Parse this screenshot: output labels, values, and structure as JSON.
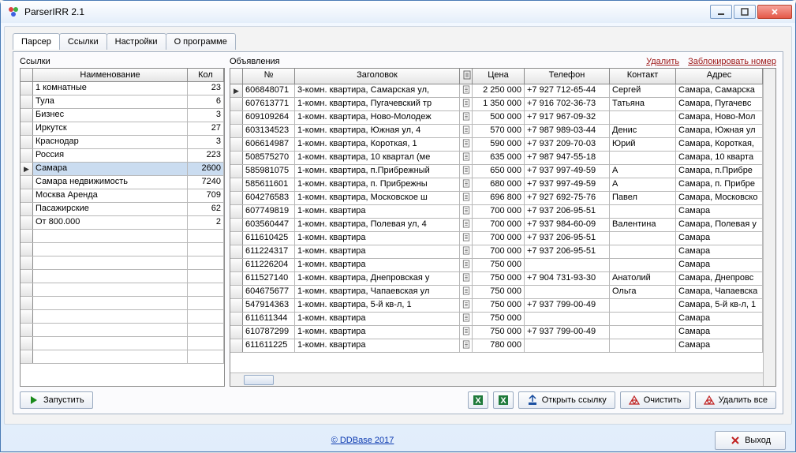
{
  "window": {
    "title": "ParserIRR 2.1"
  },
  "tabs": [
    "Парсер",
    "Ссылки",
    "Настройки",
    "О программе"
  ],
  "left": {
    "title": "Ссылки",
    "headers": [
      "Наименование",
      "Кол"
    ],
    "rows": [
      {
        "name": "1 комнатные",
        "count": "23"
      },
      {
        "name": "Тула",
        "count": "6"
      },
      {
        "name": "Бизнес",
        "count": "3"
      },
      {
        "name": "Иркутск",
        "count": "27"
      },
      {
        "name": "Краснодар",
        "count": "3"
      },
      {
        "name": "Россия",
        "count": "223"
      },
      {
        "name": "Самара",
        "count": "2600",
        "selected": true
      },
      {
        "name": "Самара недвижимость",
        "count": "7240"
      },
      {
        "name": "Москва Аренда",
        "count": "709"
      },
      {
        "name": "Пасажирские",
        "count": "62"
      },
      {
        "name": "От 800.000",
        "count": "2"
      }
    ]
  },
  "right": {
    "title": "Объявления",
    "actions": {
      "delete": "Удалить",
      "block": "Заблокировать номер"
    },
    "headers": {
      "no": "№",
      "title": "Заголовок",
      "price": "Цена",
      "phone": "Телефон",
      "contact": "Контакт",
      "address": "Адрес"
    },
    "rows": [
      {
        "no": "606848071",
        "title": "3-комн. квартира, Самарская ул,",
        "price": "2 250 000",
        "phone": "+7 927 712-65-44",
        "contact": "Сергей",
        "address": "Самара, Самарска",
        "sel": true
      },
      {
        "no": "607613771",
        "title": "1-комн. квартира, Пугачевский тр",
        "price": "1 350 000",
        "phone": "+7 916 702-36-73",
        "contact": "Татьяна",
        "address": "Самара, Пугачевс"
      },
      {
        "no": "609109264",
        "title": "1-комн. квартира, Ново-Молодеж",
        "price": "500 000",
        "phone": "+7 917 967-09-32",
        "contact": "",
        "address": "Самара, Ново-Мол"
      },
      {
        "no": "603134523",
        "title": "1-комн. квартира, Южная ул, 4",
        "price": "570 000",
        "phone": "+7 987 989-03-44",
        "contact": "Денис",
        "address": "Самара, Южная ул"
      },
      {
        "no": "606614987",
        "title": "1-комн. квартира, Короткая, 1",
        "price": "590 000",
        "phone": "+7 937 209-70-03",
        "contact": "Юрий",
        "address": "Самара, Короткая,"
      },
      {
        "no": "508575270",
        "title": "1-комн. квартира, 10 квартал (ме",
        "price": "635 000",
        "phone": "+7 987 947-55-18",
        "contact": "",
        "address": "Самара, 10 кварта"
      },
      {
        "no": "585981075",
        "title": "1-комн. квартира, п.Прибрежный",
        "price": "650 000",
        "phone": "+7 937 997-49-59",
        "contact": "А",
        "address": "Самара, п.Прибре"
      },
      {
        "no": "585611601",
        "title": "1-комн. квартира, п. Прибрежны",
        "price": "680 000",
        "phone": "+7 937 997-49-59",
        "contact": "А",
        "address": "Самара, п. Прибре"
      },
      {
        "no": "604276583",
        "title": "1-комн. квартира, Московское ш",
        "price": "696 800",
        "phone": "+7 927 692-75-76",
        "contact": "Павел",
        "address": "Самара, Московско"
      },
      {
        "no": "607749819",
        "title": "1-комн. квартира",
        "price": "700 000",
        "phone": "+7 937 206-95-51",
        "contact": "",
        "address": "Самара"
      },
      {
        "no": "603560447",
        "title": "1-комн. квартира, Полевая ул, 4",
        "price": "700 000",
        "phone": "+7 937 984-60-09",
        "contact": "Валентина",
        "address": "Самара, Полевая у"
      },
      {
        "no": "611610425",
        "title": "1-комн. квартира",
        "price": "700 000",
        "phone": "+7 937 206-95-51",
        "contact": "",
        "address": "Самара"
      },
      {
        "no": "611224317",
        "title": "1-комн. квартира",
        "price": "700 000",
        "phone": "+7 937 206-95-51",
        "contact": "",
        "address": "Самара"
      },
      {
        "no": "611226204",
        "title": "1-комн. квартира",
        "price": "750 000",
        "phone": "",
        "contact": "",
        "address": "Самара"
      },
      {
        "no": "611527140",
        "title": "1-комн. квартира, Днепровская у",
        "price": "750 000",
        "phone": "+7 904 731-93-30",
        "contact": "Анатолий",
        "address": "Самара, Днепровс"
      },
      {
        "no": "604675677",
        "title": "1-комн. квартира, Чапаевская ул",
        "price": "750 000",
        "phone": "",
        "contact": "Ольга",
        "address": "Самара, Чапаевска"
      },
      {
        "no": "547914363",
        "title": "1-комн. квартира, 5-й кв-л, 1",
        "price": "750 000",
        "phone": "+7 937 799-00-49",
        "contact": "",
        "address": "Самара, 5-й кв-л, 1"
      },
      {
        "no": "611611344",
        "title": "1-комн. квартира",
        "price": "750 000",
        "phone": "",
        "contact": "",
        "address": "Самара"
      },
      {
        "no": "610787299",
        "title": "1-комн. квартира",
        "price": "750 000",
        "phone": "+7 937 799-00-49",
        "contact": "",
        "address": "Самара"
      },
      {
        "no": "611611225",
        "title": "1-комн. квартира",
        "price": "780 000",
        "phone": "",
        "contact": "",
        "address": "Самара"
      }
    ]
  },
  "buttons": {
    "run": "Запустить",
    "open_link": "Открыть ссылку",
    "clear": "Очистить",
    "delete_all": "Удалить все",
    "exit": "Выход"
  },
  "footer": {
    "copy": "© DDBase 2017"
  }
}
